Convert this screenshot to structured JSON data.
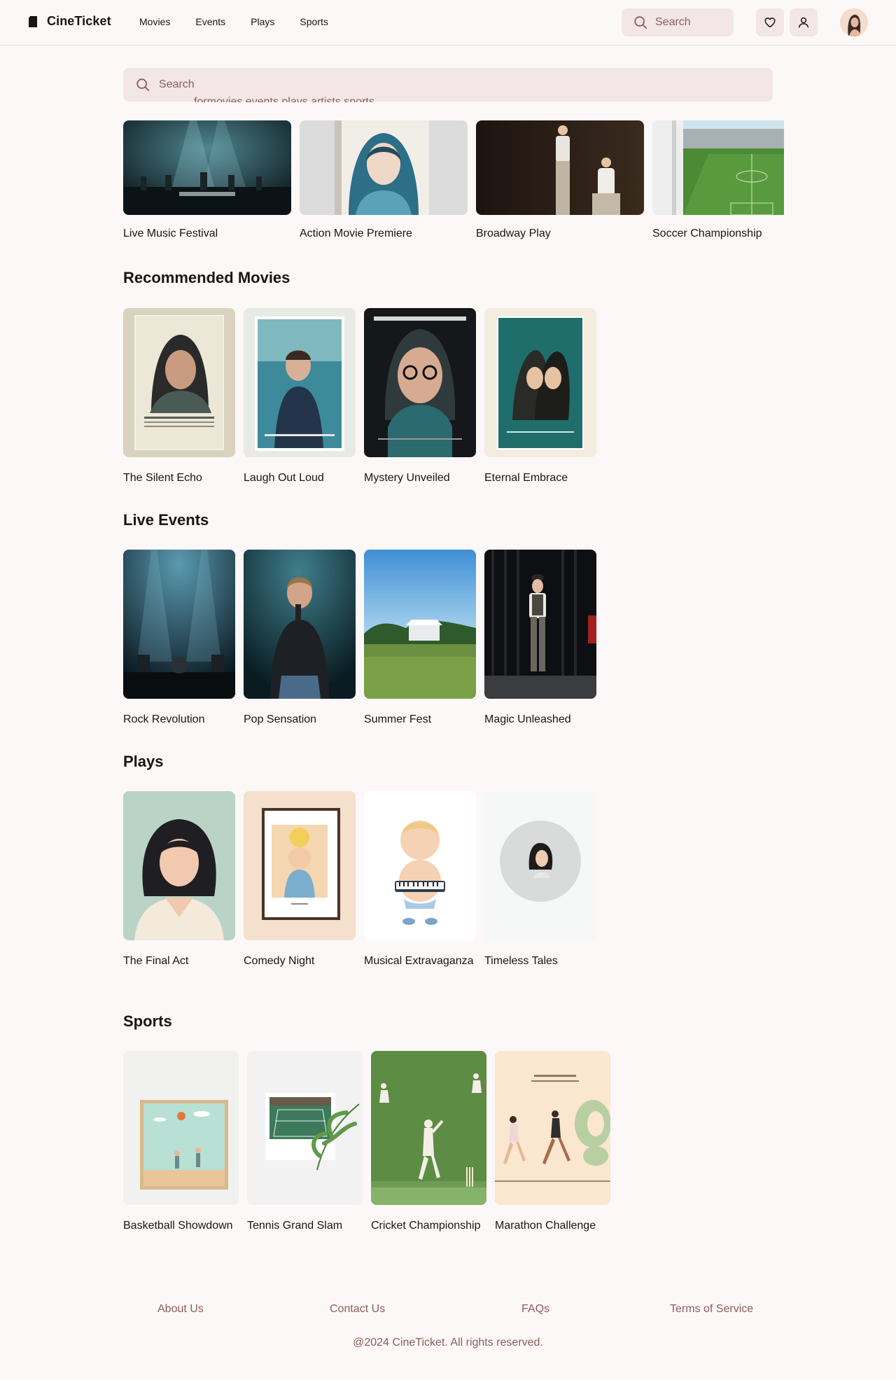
{
  "app": {
    "name": "CineTicket"
  },
  "nav": {
    "items": [
      "Movies",
      "Events",
      "Plays",
      "Sports"
    ]
  },
  "header": {
    "search_placeholder": "Search"
  },
  "search": {
    "placeholder": "Search",
    "overflow_text": "formovies,events,plays,artists,sports"
  },
  "featured": [
    {
      "title": "Live Music Festival"
    },
    {
      "title": "Action Movie Premiere"
    },
    {
      "title": "Broadway Play"
    },
    {
      "title": "Soccer Championship"
    }
  ],
  "sections": {
    "movies": {
      "title": "Recommended Movies",
      "items": [
        "The Silent Echo",
        "Laugh Out Loud",
        "Mystery Unveiled",
        "Eternal Embrace"
      ]
    },
    "events": {
      "title": "Live Events",
      "items": [
        "Rock Revolution",
        "Pop Sensation",
        "Summer Fest",
        "Magic Unleashed"
      ]
    },
    "plays": {
      "title": "Plays",
      "items": [
        "The Final Act",
        "Comedy Night",
        "Musical Extravaganza",
        "Timeless Tales"
      ]
    },
    "sports": {
      "title": "Sports",
      "items": [
        "Basketball Showdown",
        "Tennis Grand Slam",
        "Cricket Championship",
        "Marathon Challenge"
      ]
    }
  },
  "footer": {
    "links": [
      "About Us",
      "Contact Us",
      "FAQs",
      "Terms of Service"
    ],
    "copyright": "@2024 CineTicket. All rights reserved."
  },
  "colors": {
    "background": "#fbf8f7",
    "search_fill": "#f2e6e6",
    "muted_text": "#8e5d5d",
    "primary_text": "#1c1414"
  },
  "icons": [
    "logo-mark",
    "search-icon",
    "heart-icon",
    "user-icon"
  ]
}
